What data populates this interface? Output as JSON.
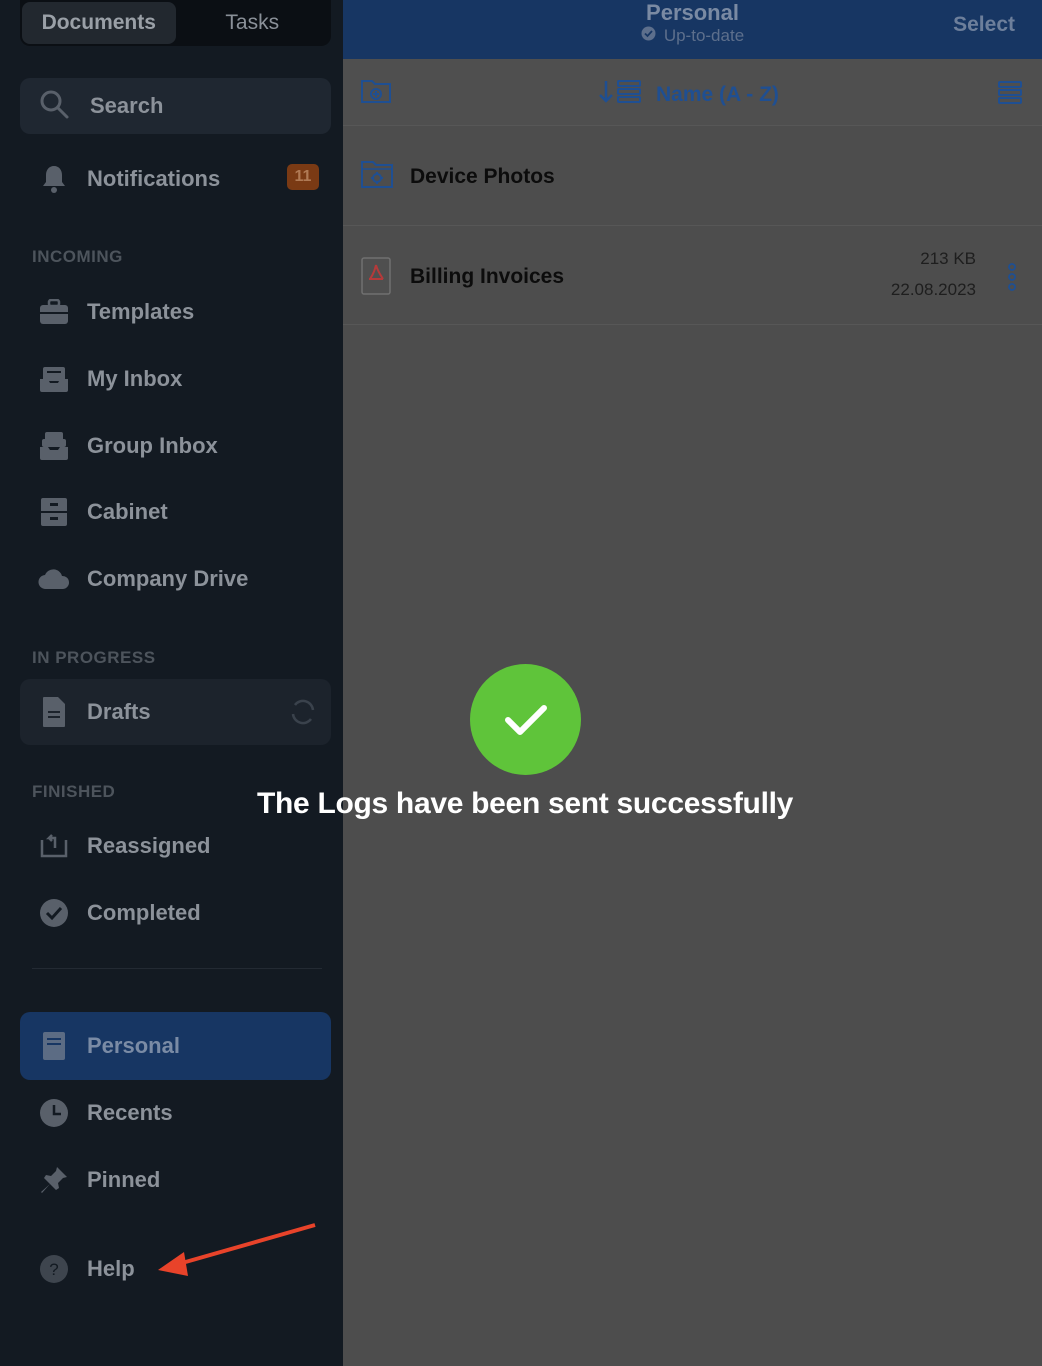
{
  "sidebar": {
    "tabs": [
      {
        "label": "Documents"
      },
      {
        "label": "Tasks"
      }
    ],
    "search_label": "Search",
    "notifications": {
      "label": "Notifications",
      "count": "11"
    },
    "sections": {
      "incoming": "INCOMING",
      "in_progress": "IN PROGRESS",
      "finished": "FINISHED"
    },
    "items": {
      "templates": "Templates",
      "my_inbox": "My Inbox",
      "group_inbox": "Group Inbox",
      "cabinet": "Cabinet",
      "company_drive": "Company Drive",
      "drafts": "Drafts",
      "reassigned": "Reassigned",
      "completed": "Completed",
      "personal": "Personal",
      "recents": "Recents",
      "pinned": "Pinned",
      "help": "Help"
    }
  },
  "header": {
    "title": "Personal",
    "status": "Up-to-date",
    "select_label": "Select"
  },
  "toolbar": {
    "sort_label": "Name (A - Z)"
  },
  "files": [
    {
      "name": "Device Photos",
      "type": "folder"
    },
    {
      "name": "Billing Invoices",
      "type": "pdf",
      "size": "213 KB",
      "date": "22.08.2023"
    }
  ],
  "toast": {
    "message": "The Logs have been sent successfully"
  },
  "colors": {
    "accent": "#173663",
    "success": "#5fc43a",
    "badge": "#7a3a14",
    "annotation_arrow": "#e8432a"
  }
}
